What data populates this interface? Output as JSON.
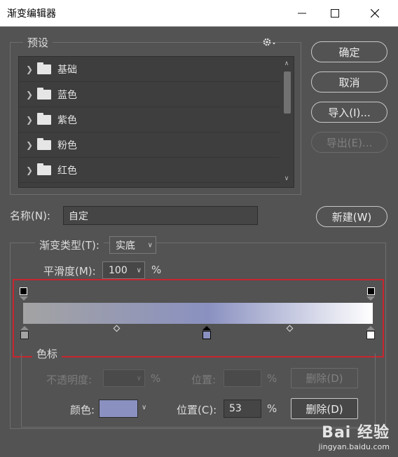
{
  "window": {
    "title": "渐变编辑器"
  },
  "presets": {
    "label": "预设",
    "folders": [
      "基础",
      "蓝色",
      "紫色",
      "粉色",
      "红色"
    ]
  },
  "buttons": {
    "ok": "确定",
    "cancel": "取消",
    "import": "导入(I)...",
    "export": "导出(E)...",
    "new": "新建(W)",
    "delete_opacity": "删除(D)",
    "delete_color": "删除(D)"
  },
  "name": {
    "label": "名称(N):",
    "value": "自定"
  },
  "gradient_type": {
    "label": "渐变类型(T):",
    "value": "实底"
  },
  "smoothness": {
    "label": "平滑度(M):",
    "value": "100",
    "unit": "%"
  },
  "stops": {
    "group_label": "色标",
    "opacity_label": "不透明度:",
    "opacity_unit": "%",
    "opacity_location_label": "位置:",
    "opacity_location_unit": "%",
    "color_label": "颜色:",
    "color_value": "#8a91c0",
    "location_label": "位置(C):",
    "location_value": "53",
    "location_unit": "%"
  },
  "gradient": {
    "stops": [
      {
        "color": "#a3a3a3",
        "location": 0
      },
      {
        "color": "#8a91c0",
        "location": 53,
        "selected": true
      },
      {
        "color": "#ffffff",
        "location": 100
      }
    ],
    "opacity_stops": [
      0,
      100
    ]
  },
  "watermark": {
    "text": "Bai 经验",
    "url": "jingyan.baidu.com"
  }
}
